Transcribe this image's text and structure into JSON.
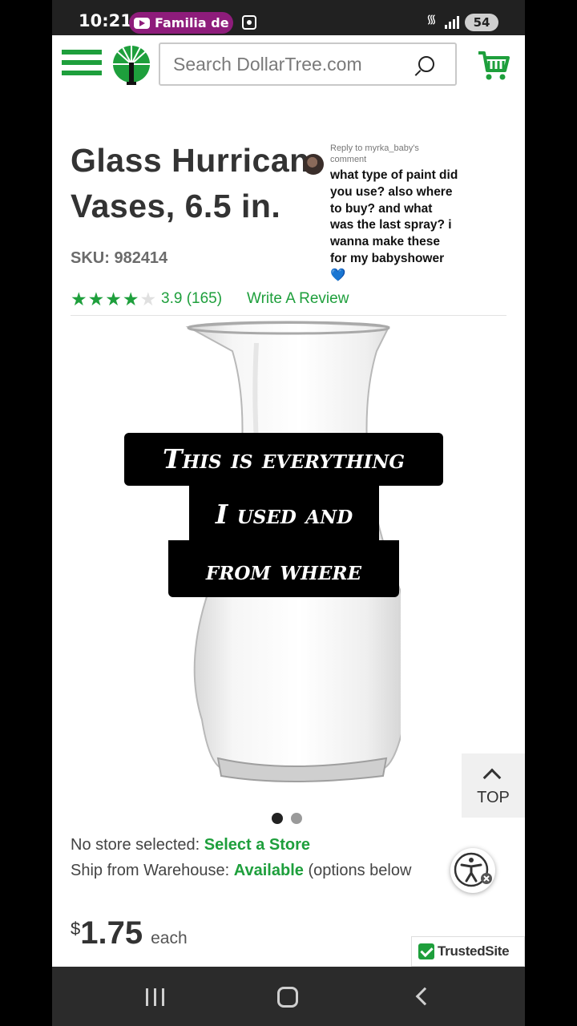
{
  "status_bar": {
    "time": "10:21",
    "notification": "Familia de",
    "battery": "54"
  },
  "header": {
    "search_placeholder": "Search DollarTree.com"
  },
  "product": {
    "title": "Glass Hurrican Vases, 6.5 in.",
    "sku": "SKU: 982414",
    "rating_stars": 4,
    "rating_text": "3.9 (165)",
    "write_review": "Write A Review",
    "image_index": 1,
    "image_count": 2
  },
  "comment": {
    "reply_to": "Reply to myrka_baby's comment",
    "text": "what type of paint did you use? also where to buy? and what was the last spray? i wanna make these for my babyshower 💙"
  },
  "caption": {
    "line1": "This is everything",
    "line2": "I used and",
    "line3": "from where"
  },
  "availability": {
    "store_label": "No store selected:",
    "store_link": "Select a Store",
    "ship_label": "Ship from Warehouse:",
    "ship_status": "Available",
    "ship_note": "(options below"
  },
  "price": {
    "currency": "$",
    "amount": "1.75",
    "unit": "each"
  },
  "top_button": "TOP",
  "trusted_site": "TrustedSite",
  "colors": {
    "brand_green": "#1e9f3c",
    "text_dark": "#333333"
  }
}
